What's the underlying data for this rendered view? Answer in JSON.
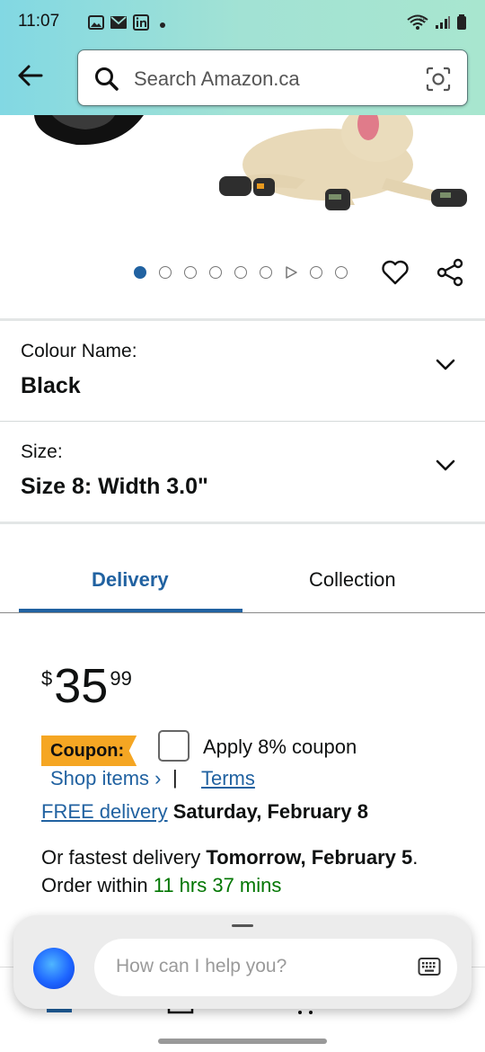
{
  "status_bar": {
    "time": "11:07",
    "left_icons": [
      "photo-icon",
      "mail-icon",
      "linkedin-icon",
      "dot-icon"
    ],
    "right_icons": [
      "wifi-6e-icon",
      "signal-icon",
      "battery-icon"
    ]
  },
  "header": {
    "search_placeholder": "Search Amazon.ca"
  },
  "carousel": {
    "image_count": 9,
    "active_index": 0,
    "video_index": 6
  },
  "variants": {
    "colour_label": "Colour Name:",
    "colour_value": "Black",
    "size_label": "Size:",
    "size_value": "Size 8: Width 3.0\""
  },
  "tabs": {
    "delivery": "Delivery",
    "collection": "Collection",
    "active": "Delivery"
  },
  "price": {
    "currency": "$",
    "whole": "35",
    "fraction": "99"
  },
  "coupon": {
    "badge": "Coupon:",
    "apply_text": "Apply 8% coupon",
    "checked": false,
    "shop_items": "Shop items ›",
    "separator": "|",
    "terms": "Terms"
  },
  "delivery": {
    "free_link": "FREE delivery",
    "free_date": "Saturday, February 8",
    "fastest_prefix": "Or fastest delivery",
    "fastest_date": "Tomorrow, February 5",
    "fastest_suffix": ".",
    "order_within_prefix": "Order within",
    "order_within_time": "11 hrs 37 mins"
  },
  "assistant": {
    "placeholder": "How can I help you?"
  },
  "colors": {
    "accent_blue": "#2162a1",
    "coupon_orange": "#f5a623",
    "green": "#007600",
    "header_gradient_start": "#82d8e3",
    "header_gradient_end": "#a8e6cf"
  }
}
